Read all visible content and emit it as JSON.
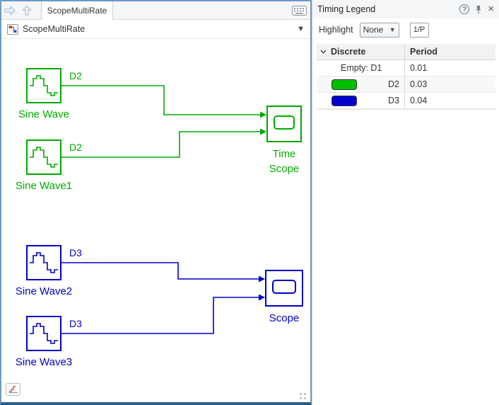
{
  "editor": {
    "tab": "ScopeMultiRate",
    "breadcrumb": "ScopeMultiRate",
    "colors": {
      "d2_green": "#00AA00",
      "d3_blue": "#0000C8"
    },
    "blocks": {
      "sine1": {
        "label": "Sine Wave",
        "rate": "D2"
      },
      "sine2": {
        "label": "Sine Wave1",
        "rate": "D2"
      },
      "sine3": {
        "label": "Sine Wave2",
        "rate": "D3"
      },
      "sine4": {
        "label": "Sine Wave3",
        "rate": "D3"
      },
      "timescope": {
        "label": "Time Scope"
      },
      "scope": {
        "label": "Scope"
      }
    }
  },
  "legend": {
    "title": "Timing Legend",
    "highlight_label": "Highlight",
    "highlight_value": "None",
    "inverse_period": "1/P",
    "table": {
      "col_discrete": "Discrete",
      "col_period": "Period",
      "rows": [
        {
          "label": "Empty: D1",
          "period": "0.01"
        },
        {
          "label": "D2",
          "period": "0.03",
          "swatch": "#00BE00"
        },
        {
          "label": "D3",
          "period": "0.04",
          "swatch": "#0000CD"
        }
      ]
    }
  }
}
